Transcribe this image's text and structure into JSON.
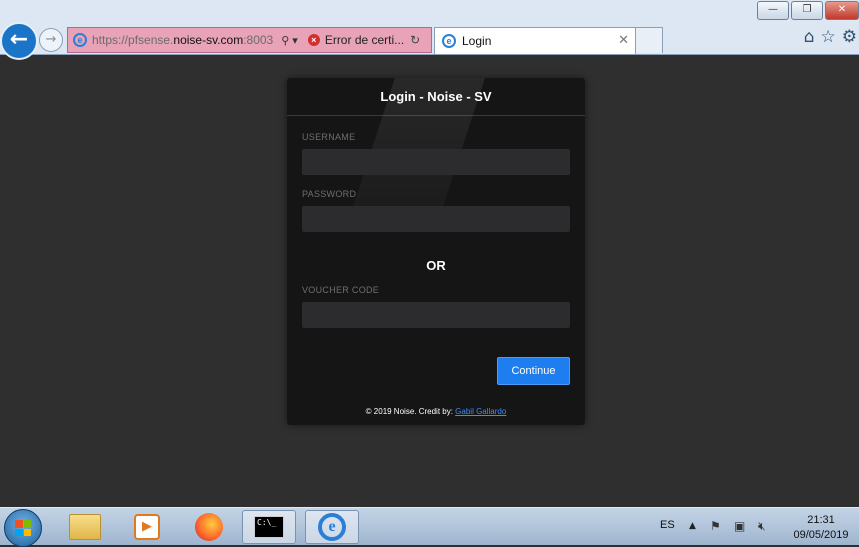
{
  "browser": {
    "url_prefix": "https://pfsense.",
    "url_domain": "noise-sv.com",
    "url_port": ":8003",
    "search_glyph": "⚲",
    "dropdown_glyph": "▾",
    "cert_error_label": "Error de certi...",
    "tab_label": "Login",
    "tab_close_glyph": "✕",
    "back_glyph": "←",
    "forward_glyph": "→",
    "refresh_glyph": "↻",
    "home_glyph": "⌂",
    "star_glyph": "☆",
    "gear_glyph": "⚙",
    "window_minimize": "—",
    "window_restore": "❐",
    "window_close": "✕"
  },
  "login": {
    "title": "Login - Noise - SV",
    "username_label": "USERNAME",
    "password_label": "PASSWORD",
    "or_label": "OR",
    "voucher_label": "VOUCHER CODE",
    "continue_label": "Continue",
    "footer_text": "© 2019 Noise. Credit by: ",
    "footer_link": "Gabil Gallardo"
  },
  "taskbar": {
    "cmd_text": "C:\\_",
    "language": "ES",
    "tray_arrow": "▲",
    "time": "21:31",
    "date": "09/05/2019"
  },
  "colors": {
    "accent_blue": "#1e7ef0",
    "card_bg": "#151515",
    "page_bg": "#2f2f2f",
    "address_error_bg": "#e8a3b8"
  }
}
